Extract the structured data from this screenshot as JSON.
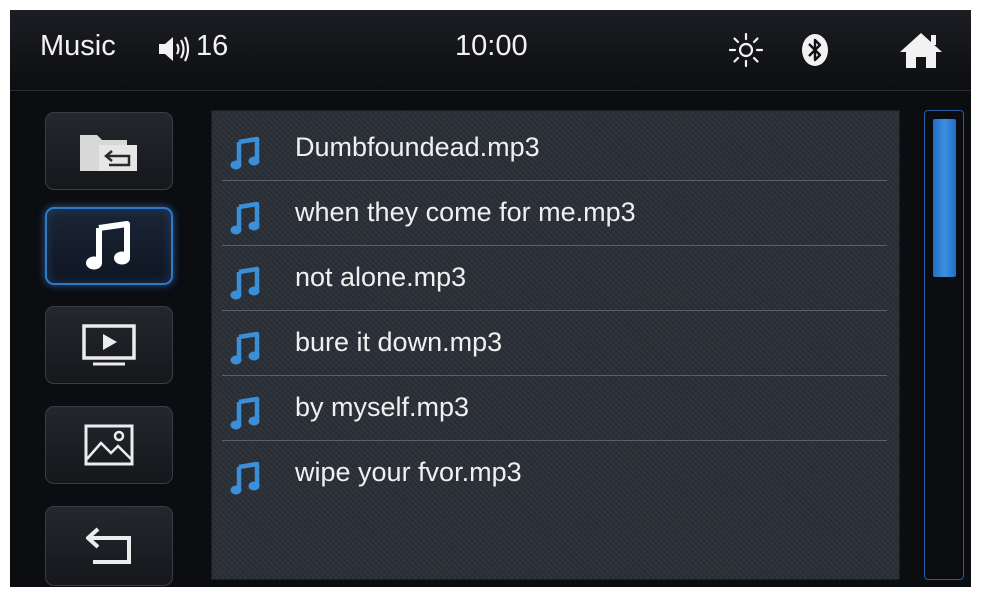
{
  "status_bar": {
    "title": "Music",
    "volume": "16",
    "time": "10:00",
    "icons": [
      "volume-icon",
      "brightness-icon",
      "bluetooth-icon",
      "home-icon"
    ]
  },
  "sidebar": {
    "items": [
      {
        "name": "folder-back",
        "icon": "folder-back-icon",
        "active": false
      },
      {
        "name": "music",
        "icon": "music-note-icon",
        "active": true
      },
      {
        "name": "video",
        "icon": "video-play-icon",
        "active": false
      },
      {
        "name": "photo",
        "icon": "image-icon",
        "active": false
      },
      {
        "name": "back",
        "icon": "return-arrow-icon",
        "active": false
      }
    ]
  },
  "track_list": {
    "tracks": [
      "Dumbfoundead.mp3",
      "when they come for me.mp3",
      "not alone.mp3",
      "bure it down.mp3",
      "by myself.mp3",
      "wipe your fvor.mp3"
    ]
  },
  "scrollbar": {
    "position": 0.0,
    "visible_fraction": 0.34
  },
  "colors": {
    "accent": "#2f79c9",
    "note_icon": "#3b8fd9",
    "background": "#0b0d11"
  }
}
